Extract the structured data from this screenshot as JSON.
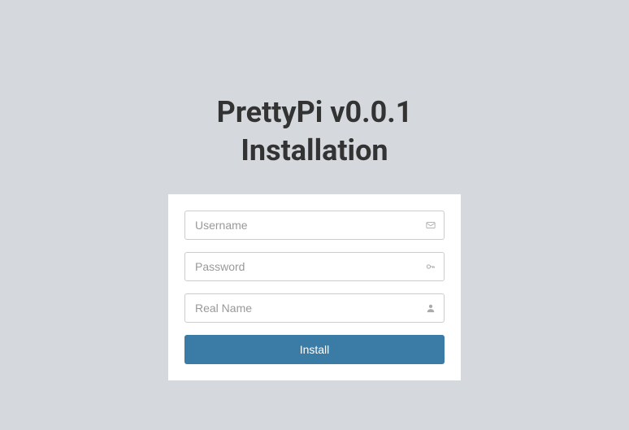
{
  "header": {
    "title_line1": "PrettyPi v0.0.1",
    "title_line2": "Installation"
  },
  "form": {
    "username": {
      "placeholder": "Username",
      "value": ""
    },
    "password": {
      "placeholder": "Password",
      "value": ""
    },
    "realname": {
      "placeholder": "Real Name",
      "value": ""
    },
    "submit_label": "Install"
  }
}
